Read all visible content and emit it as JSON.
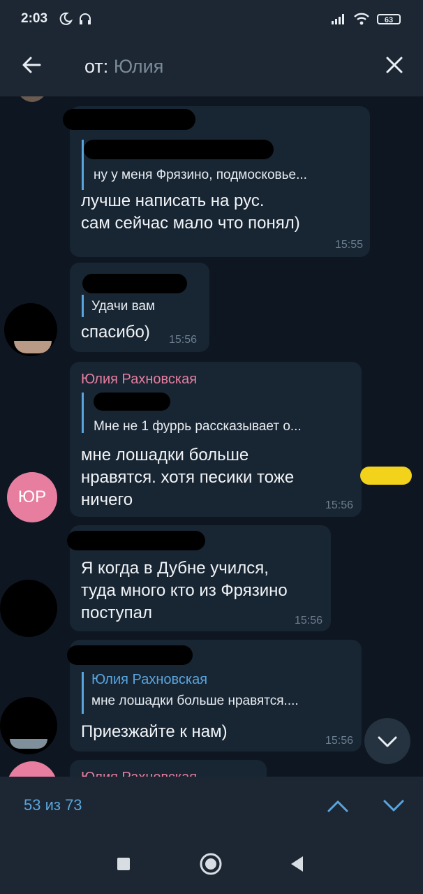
{
  "status_bar": {
    "time": "2:03",
    "battery": "63"
  },
  "header": {
    "search_prefix": "от:",
    "search_name": "Юлия"
  },
  "messages": [
    {
      "quote": "ну у меня Фрязино, подмосковье...",
      "text": "лучше написать на рус.\nсам сейчас мало что понял)",
      "time": "15:55"
    },
    {
      "quote": "Удачи вам",
      "text": "спасибо)",
      "time": "15:56"
    },
    {
      "author": "Юлия Рахновская",
      "quote": "Мне не 1 фуррь рассказывает о...",
      "text": "мне лошадки больше\nнравятся. хотя песики тоже\nничего",
      "time": "15:56",
      "avatar_initials": "ЮР"
    },
    {
      "text": "Я когда в Дубне учился,\nтуда много кто из Фрязино\nпоступал",
      "time": "15:56"
    },
    {
      "quote_author": "Юлия Рахновская",
      "quote": "мне лошадки больше нравятся....",
      "text": "Приезжайте к нам)",
      "time": "15:56"
    },
    {
      "author": "Юлия Рахновская"
    }
  ],
  "search_nav": {
    "counter": "53 из 73"
  },
  "colors": {
    "accent": "#5aa5de",
    "author_pink": "#e77ea0",
    "avatar_pink": "#e77ea0",
    "bubble": "#182533",
    "background": "#0e1621",
    "bar": "#1c2733"
  }
}
